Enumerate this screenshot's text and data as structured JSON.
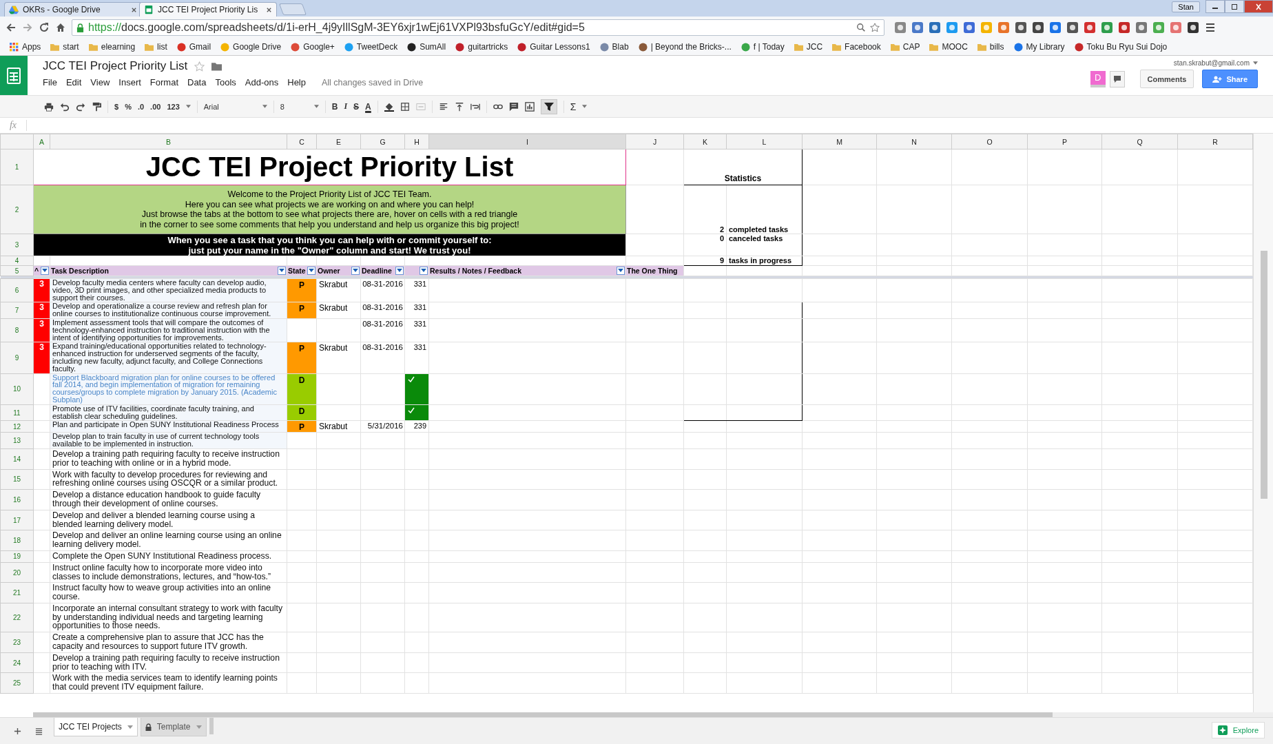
{
  "browser": {
    "tabs": [
      {
        "title": "OKRs - Google Drive",
        "selected": false
      },
      {
        "title": "JCC TEI Project Priority Lis",
        "selected": true
      }
    ],
    "profile": "Stan",
    "url_scheme": "https://",
    "url_rest": "docs.google.com/spreadsheets/d/1i-erH_4j9yIllSgM-3EY6xjr1wEj61VXPl93bsfuGcY/edit#gid=5",
    "bookmarks": [
      {
        "label": "Apps",
        "kind": "apps"
      },
      {
        "label": "start",
        "kind": "folder"
      },
      {
        "label": "elearning",
        "kind": "folder"
      },
      {
        "label": "list",
        "kind": "folder"
      },
      {
        "label": "Gmail",
        "kind": "site",
        "color": "#d93025"
      },
      {
        "label": "Google Drive",
        "kind": "site",
        "color": "#f4b400"
      },
      {
        "label": "Google+",
        "kind": "site",
        "color": "#dd4b39"
      },
      {
        "label": "TweetDeck",
        "kind": "site",
        "color": "#1da1f2"
      },
      {
        "label": "SumAll",
        "kind": "site",
        "color": "#222222"
      },
      {
        "label": "guitartricks",
        "kind": "site",
        "color": "#c0202a"
      },
      {
        "label": "Guitar Lessons1",
        "kind": "site",
        "color": "#c0202a"
      },
      {
        "label": "Blab",
        "kind": "site",
        "color": "#7a8aa8"
      },
      {
        "label": "| Beyond the Bricks-...",
        "kind": "site",
        "color": "#8a5a3a"
      },
      {
        "label": "f | Today",
        "kind": "site",
        "color": "#3aa84a"
      },
      {
        "label": "JCC",
        "kind": "folder"
      },
      {
        "label": "Facebook",
        "kind": "folder"
      },
      {
        "label": "CAP",
        "kind": "folder"
      },
      {
        "label": "MOOC",
        "kind": "folder"
      },
      {
        "label": "bills",
        "kind": "folder"
      },
      {
        "label": "My Library",
        "kind": "site",
        "color": "#1a73e8"
      },
      {
        "label": "Toku Bu Ryu Sui Dojo",
        "kind": "site",
        "color": "#c62828"
      }
    ]
  },
  "doc": {
    "title": "JCC TEI Project Priority List",
    "menus": [
      "File",
      "Edit",
      "View",
      "Insert",
      "Format",
      "Data",
      "Tools",
      "Add-ons",
      "Help"
    ],
    "save_status": "All changes saved in Drive",
    "account": "stan.skrabut@gmail.com",
    "avatar": "D",
    "comments_button": "Comments",
    "share_button": "Share"
  },
  "toolbar": {
    "number_buttons": [
      "$",
      "%",
      ".0",
      ".00"
    ],
    "number_format": "123",
    "font": "Arial",
    "font_size": "8",
    "style_buttons": [
      "B",
      "I",
      "S",
      "A"
    ],
    "function_button": "Σ"
  },
  "formula_bar": {
    "label": "fx"
  },
  "sheet": {
    "columns": [
      "A",
      "B",
      "C",
      "E",
      "G",
      "H",
      "I",
      "J",
      "K",
      "L",
      "M",
      "N",
      "O",
      "P",
      "Q",
      "R"
    ],
    "title": {
      "row": "1",
      "text": "JCC TEI Project Priority List"
    },
    "welcome": {
      "row": "2",
      "lines": [
        "Welcome to the Project Priority List of JCC TEI Team.",
        "Here you can see what projects we are working on and where you can help!",
        "Just browse the tabs at the bottom to see what projects there are, hover on cells with a red triangle",
        "in the corner to see some comments that help you understand and help us organize this big project!"
      ]
    },
    "instructions": {
      "row": "3",
      "lines": [
        "When you see a task that you think you can help with or commit yourself to:",
        "just put your name in the \"Owner\" column and start! We trust you!"
      ]
    },
    "spacer_row": "4",
    "header_row": {
      "row": "5",
      "cells": [
        {
          "label": "^",
          "filter": true
        },
        {
          "label": "Task Description",
          "filter": true
        },
        {
          "label": "State",
          "filter": true
        },
        {
          "label": "Owner",
          "filter": true
        },
        {
          "label": "Deadline",
          "filter": true
        },
        {
          "filter": true
        },
        {
          "label": "Results / Notes / Feedback",
          "filter": true
        },
        {
          "label": "The One Thing",
          "filter": false
        }
      ]
    },
    "statistics": {
      "title": "Statistics",
      "items": [
        {
          "count": "2",
          "label": "completed tasks"
        },
        {
          "count": "0",
          "label": "canceled tasks"
        },
        {
          "count": "9",
          "label": "tasks in progress"
        }
      ]
    },
    "tasks": [
      {
        "row": "6",
        "kind": "compact",
        "priority": "3",
        "description": "Develop faculty media centers where faculty can develop audio, video, 3D print images, and other specialized media products to support their courses.",
        "state": {
          "letter": "P",
          "color": "#ff9900"
        },
        "owner": "Skrabut",
        "deadline": "08-31-2016",
        "days": "331",
        "done": false
      },
      {
        "row": "7",
        "kind": "compact",
        "priority": "3",
        "description": "Develop and operationalize a course review and refresh plan for online courses to institutionalize continuous course improvement.",
        "state": {
          "letter": "P",
          "color": "#ff9900"
        },
        "owner": "Skrabut",
        "deadline": "08-31-2016",
        "days": "331",
        "done": false
      },
      {
        "row": "8",
        "kind": "compact",
        "priority": "3",
        "description": "Implement assessment tools that will compare the outcomes of technology-enhanced instruction to traditional instruction with the intent of identifying opportunities for improvements.",
        "deadline": "08-31-2016",
        "days": "331",
        "done": false
      },
      {
        "row": "9",
        "kind": "compact",
        "priority": "3",
        "description": "Expand training/educational opportunities related to technology-enhanced instruction for underserved segments of the faculty, including new faculty, adjunct faculty, and College Connections faculty.",
        "state": {
          "letter": "P",
          "color": "#ff9900"
        },
        "owner": "Skrabut",
        "deadline": "08-31-2016",
        "days": "331",
        "done": false
      },
      {
        "row": "10",
        "kind": "linked",
        "description": "Support Blackboard migration plan for online courses to be offered fall 2014, and begin implementation of migration for remaining courses/groups to complete migration by January 2015. (Academic Subplan)",
        "state": {
          "letter": "D",
          "color": "#99cc00"
        },
        "done": true
      },
      {
        "row": "11",
        "kind": "compact",
        "description": "Promote use of ITV facilities, coordinate faculty training, and establish clear scheduling guidelines.",
        "state": {
          "letter": "D",
          "color": "#99cc00"
        },
        "done": true
      },
      {
        "row": "12",
        "kind": "compact",
        "description": "Plan and participate in Open SUNY Institutional Readiness Process",
        "state": {
          "letter": "P",
          "color": "#ff9900"
        },
        "owner": "Skrabut",
        "deadline": "5/31/2016",
        "days": "239",
        "done": false
      },
      {
        "row": "13",
        "kind": "compact",
        "description": "Develop plan to train faculty in use of current technology tools available to be implemented in instruction.",
        "done": false
      },
      {
        "row": "14",
        "kind": "plain",
        "description": "Develop a training path requiring faculty to receive instruction prior to teaching with online or in a hybrid mode.",
        "done": false
      },
      {
        "row": "15",
        "kind": "plain",
        "description": "Work with faculty to develop procedures for reviewing and refreshing online courses using OSCQR or a similar product.",
        "done": false
      },
      {
        "row": "16",
        "kind": "plain",
        "description": "Develop a distance education handbook to guide faculty through their development of online courses.",
        "done": false
      },
      {
        "row": "17",
        "kind": "plain",
        "description": "Develop and deliver a blended learning course using a blended learning delivery model.",
        "done": false
      },
      {
        "row": "18",
        "kind": "plain",
        "description": "Develop and deliver an online learning course using an online learning delivery model.",
        "done": false
      },
      {
        "row": "19",
        "kind": "plain",
        "description": "Complete the Open SUNY Institutional Readiness process.",
        "done": false
      },
      {
        "row": "20",
        "kind": "plain",
        "description": "Instruct online faculty how to incorporate more video into classes to include demonstrations, lectures, and “how-tos.”",
        "done": false
      },
      {
        "row": "21",
        "kind": "plain",
        "description": "Instruct faculty how to weave group activities into an online course.",
        "done": false
      },
      {
        "row": "22",
        "kind": "plain",
        "description": "Incorporate an internal consultant strategy to work with faculty by understanding individual needs and targeting learning opportunities to those needs.",
        "done": false
      },
      {
        "row": "23",
        "kind": "plain",
        "description": "Create a comprehensive plan to assure that JCC has the capacity and resources to support future ITV growth.",
        "done": false
      },
      {
        "row": "24",
        "kind": "plain",
        "description": "Develop a training path requiring faculty to receive instruction prior to teaching with ITV.",
        "done": false
      },
      {
        "row": "25",
        "kind": "plain",
        "description": "Work with the media services team to identify learning points that could prevent ITV equipment failure.",
        "done": false
      }
    ]
  },
  "sheet_tabs": [
    {
      "label": "JCC TEI Projects",
      "selected": true,
      "locked": false
    },
    {
      "label": "Template",
      "selected": false,
      "locked": true
    }
  ],
  "explore_button": "Explore"
}
